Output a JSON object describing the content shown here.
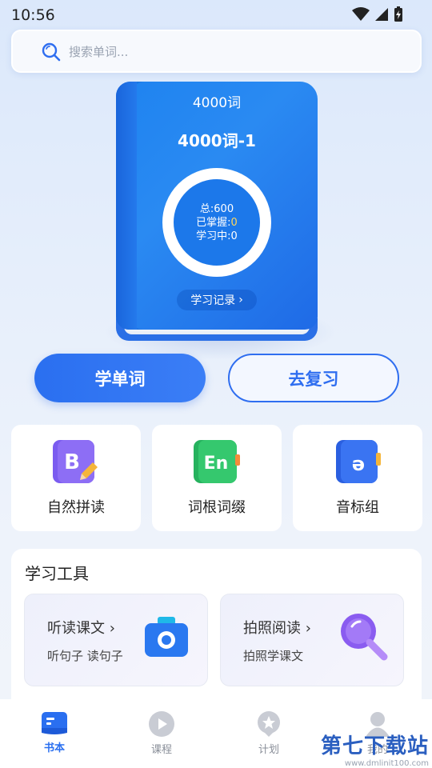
{
  "status": {
    "time": "10:56"
  },
  "search": {
    "placeholder": "搜索单词..."
  },
  "book": {
    "title": "4000词",
    "subtitle": "4000词-1",
    "total": "总:600",
    "mastered_label": "已掌握:",
    "mastered_value": "0",
    "learning": "学习中:0",
    "record": "学习记录",
    "record_arrow": "›"
  },
  "actions": {
    "learn": "学单词",
    "review": "去复习"
  },
  "features": [
    {
      "label": "自然拼读",
      "icon": "phonics-b-icon",
      "color": "#7b5cf0"
    },
    {
      "label": "词根词缀",
      "icon": "en-root-icon",
      "color": "#2cc26a"
    },
    {
      "label": "音标组",
      "icon": "phonetic-symbol-icon",
      "color": "#2f6ef0"
    }
  ],
  "tools": {
    "heading": "学习工具",
    "items": [
      {
        "title": "听读课文 ›",
        "desc": "听句子 读句子",
        "icon": "camera-icon"
      },
      {
        "title": "拍照阅读 ›",
        "desc": "拍照学课文",
        "icon": "magnifier-icon"
      }
    ]
  },
  "nav": [
    {
      "label": "书本",
      "icon": "book-icon",
      "active": true
    },
    {
      "label": "课程",
      "icon": "play-icon",
      "active": false
    },
    {
      "label": "计划",
      "icon": "plan-icon",
      "active": false
    },
    {
      "label": "我的",
      "icon": "user-icon",
      "active": false
    }
  ],
  "watermark": {
    "brand": "第七下载站",
    "url": "www.dmlinit100.com"
  },
  "colors": {
    "accent": "#2f6ef0",
    "book": "#1e83f0"
  }
}
